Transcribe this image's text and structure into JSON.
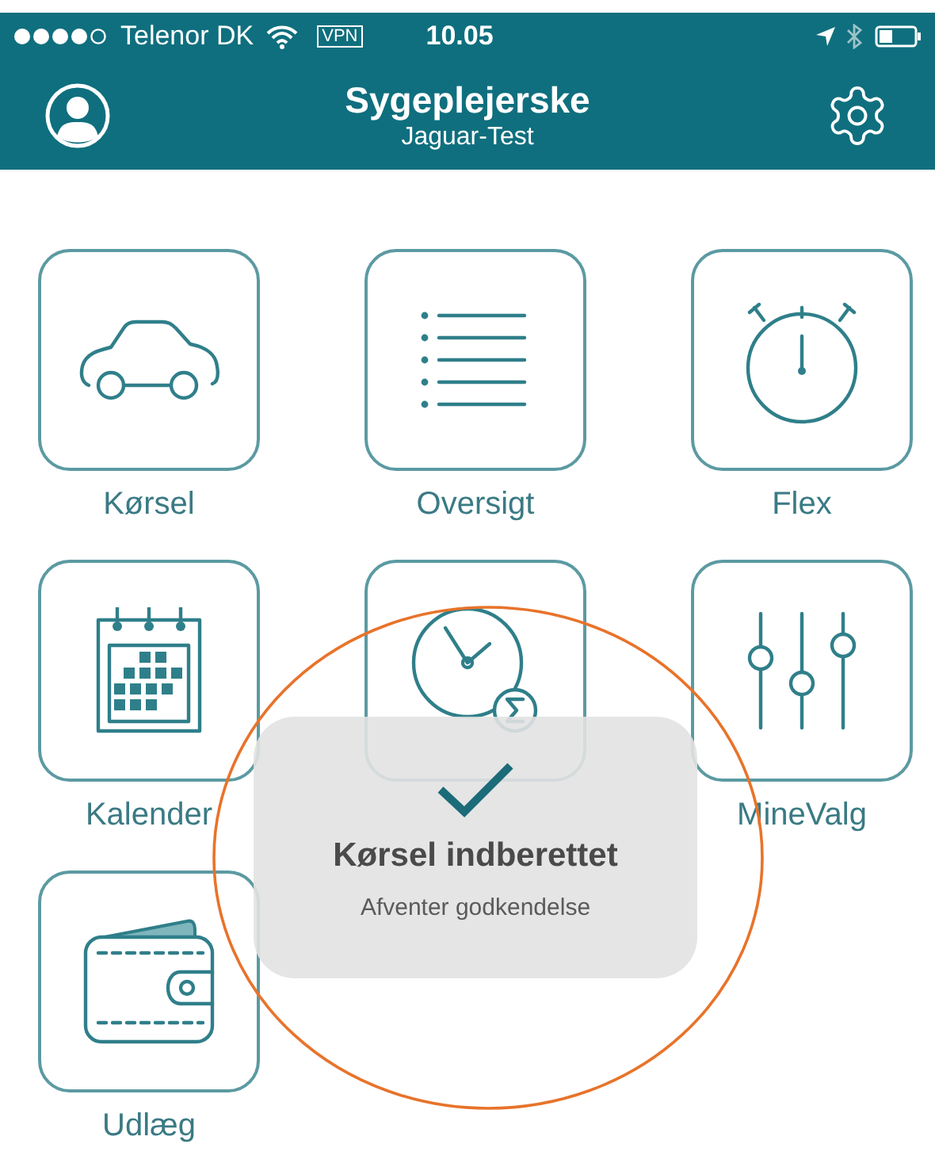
{
  "status_bar": {
    "carrier": "Telenor DK",
    "vpn": "VPN",
    "time": "10.05"
  },
  "header": {
    "title": "Sygeplejerske",
    "subtitle": "Jaguar-Test"
  },
  "tiles": [
    {
      "label": "Kørsel",
      "kind": "car"
    },
    {
      "label": "Oversigt",
      "kind": "list"
    },
    {
      "label": "Flex",
      "kind": "stopwatch"
    },
    {
      "label": "Kalender",
      "kind": "calendar"
    },
    {
      "kind": "clock"
    },
    {
      "label": "MineValg",
      "kind": "sliders"
    },
    {
      "label": "Udlæg",
      "kind": "wallet"
    }
  ],
  "toast": {
    "title": "Kørsel indberettet",
    "message": "Afventer godkendelse"
  }
}
